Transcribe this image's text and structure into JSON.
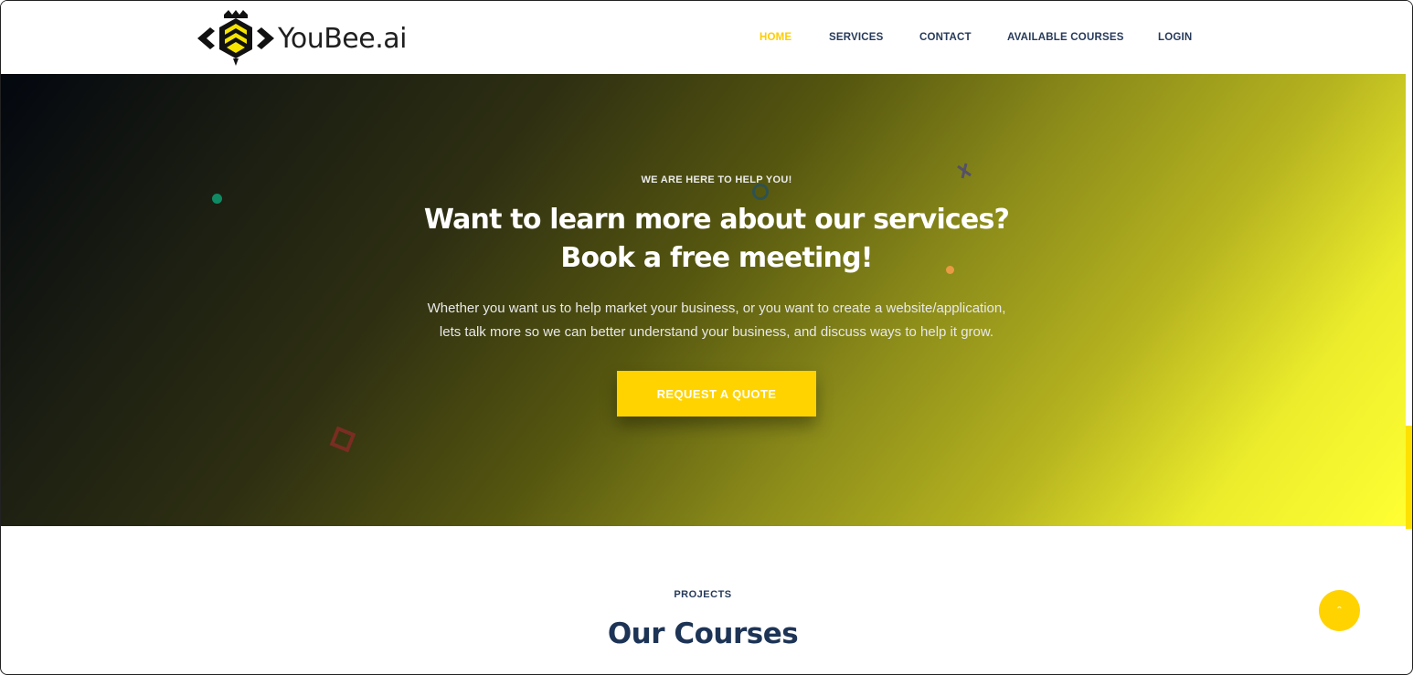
{
  "brand": {
    "name": "YouBee.ai",
    "logo_icon": "bee-hexagon-icon"
  },
  "nav": {
    "items": [
      {
        "label": "HOME",
        "active": true
      },
      {
        "label": "SERVICES",
        "active": false
      },
      {
        "label": "CONTACT",
        "active": false
      },
      {
        "label": "AVAILABLE COURSES",
        "active": false
      },
      {
        "label": "LOGIN",
        "active": false
      }
    ]
  },
  "hero": {
    "eyebrow": "WE ARE HERE TO HELP YOU!",
    "headline_line1": "Want to learn more about our services?",
    "headline_line2": "Book a free meeting!",
    "subtext_line1": "Whether you want us to help market your business, or you want to create a website/application,",
    "subtext_line2": "lets talk more so we can better understand your business, and discuss ways to help it grow.",
    "cta_label": "REQUEST A QUOTE"
  },
  "section": {
    "label": "PROJECTS",
    "title": "Our Courses"
  },
  "scroll_top": {
    "icon": "chevron-up-icon",
    "glyph": "ˆ"
  },
  "colors": {
    "accent": "#ffd300",
    "nav_text": "#263a5a",
    "heading": "#1d3456"
  }
}
